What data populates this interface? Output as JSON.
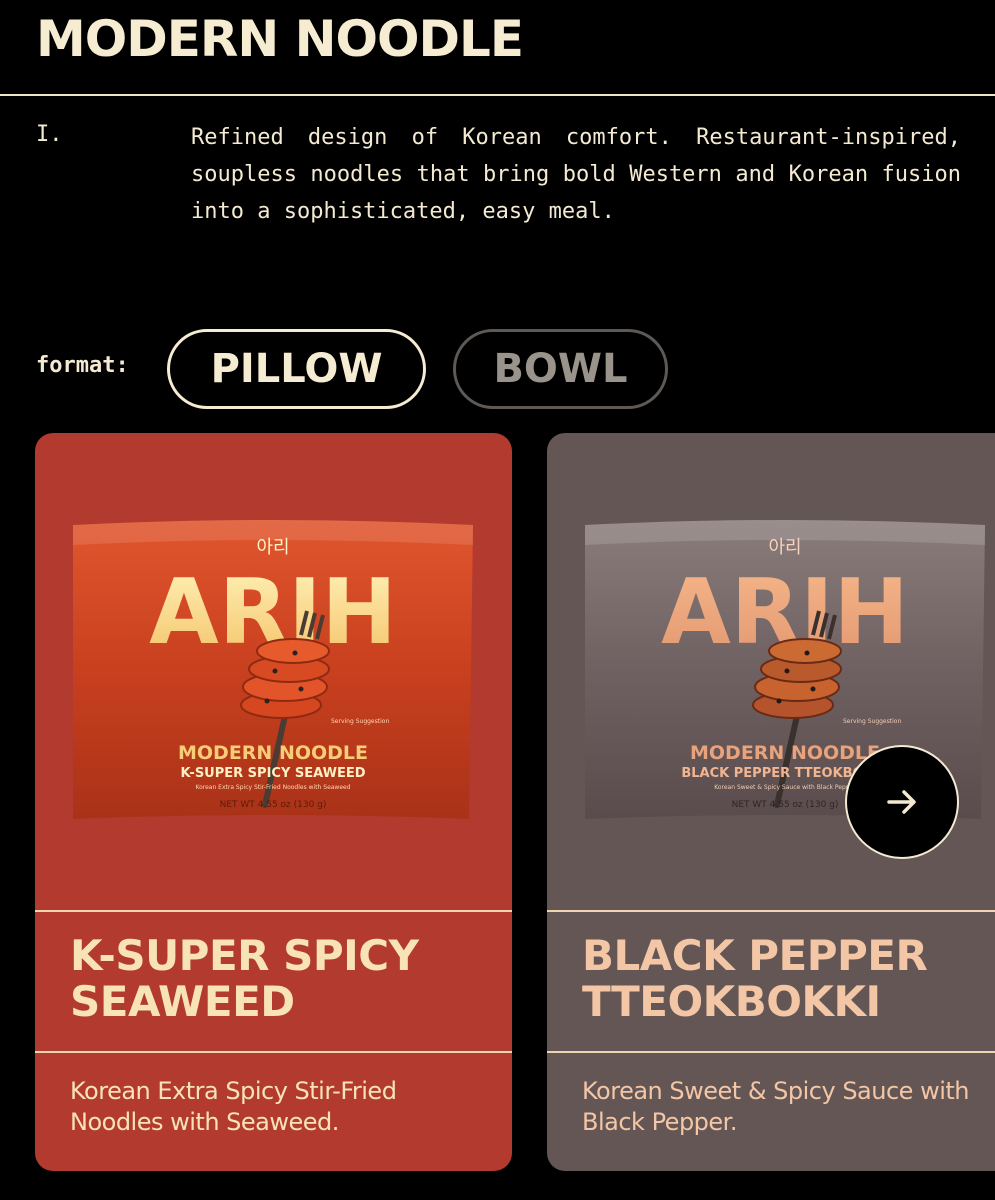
{
  "header": {
    "title": "MODERN NOODLE"
  },
  "intro": {
    "number": "I.",
    "text": "Refined design of Korean comfort. Restaurant-inspired, soupless noodles that bring bold Western and Korean fusion into a sophisticated, easy meal."
  },
  "format": {
    "label": "format:",
    "options": [
      {
        "label": "PILLOW",
        "selected": true
      },
      {
        "label": "BOWL",
        "selected": false
      }
    ]
  },
  "products": [
    {
      "name": "K-SUPER SPICY\nSEAWEED",
      "description": "Korean Extra Spicy Stir-Fried Noodles with Seaweed.",
      "card_color": "#b23a2f",
      "package": {
        "korean": "아리",
        "brand": "ARIH",
        "line": "MODERN NOODLE",
        "flavor": "K-SUPER SPICY SEAWEED",
        "sub": "Korean Extra Spicy Stir-Fried Noodles with Seaweed",
        "serving": "Serving Suggestion",
        "weight": "NET WT 4.55 oz (130 g)"
      }
    },
    {
      "name": "BLACK PEPPER\nTTEOKBOKKI",
      "description": "Korean Sweet & Spicy Sauce with Black Pepper.",
      "card_color": "#635655",
      "package": {
        "korean": "아리",
        "brand": "ARIH",
        "line": "MODERN NOODLE",
        "flavor": "BLACK PEPPER TTEOKBOKKI",
        "sub": "Korean Sweet & Spicy Sauce with Black Pepper",
        "serving": "Serving Suggestion",
        "weight": "NET WT 4.55 oz (130 g)"
      }
    }
  ],
  "carousel": {
    "next_icon": "arrow-right-icon"
  }
}
